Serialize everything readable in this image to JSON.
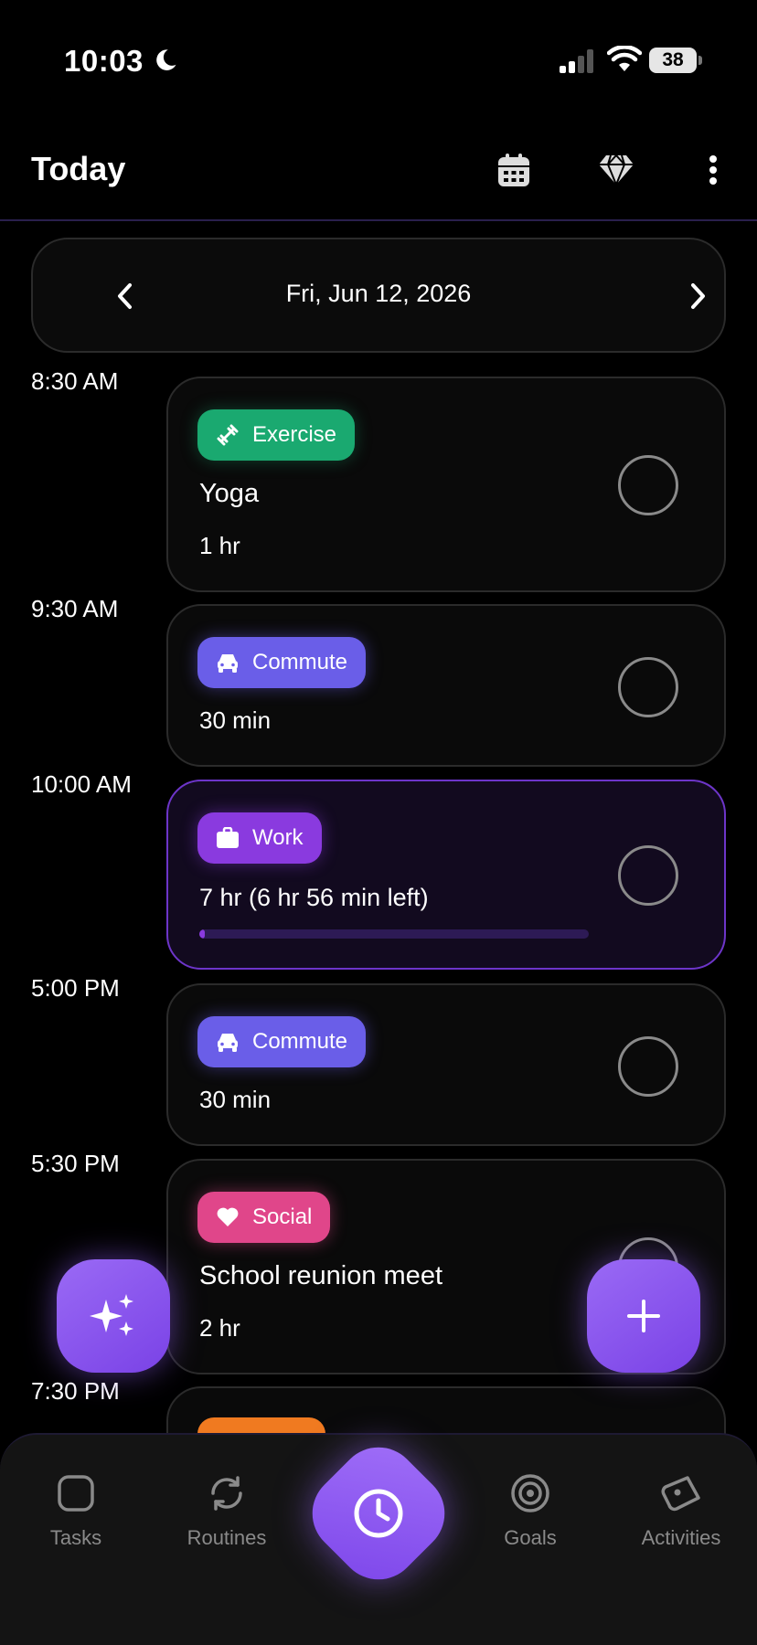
{
  "status": {
    "time": "10:03",
    "battery": "38"
  },
  "header": {
    "title": "Today"
  },
  "date_nav": {
    "date": "Fri, Jun 12, 2026"
  },
  "timeline": [
    {
      "time": "8:30 AM",
      "tag": "Exercise",
      "title": "Yoga",
      "duration": "1 hr"
    },
    {
      "time": "9:30 AM",
      "tag": "Commute",
      "duration": "30 min"
    },
    {
      "time": "10:00 AM",
      "tag": "Work",
      "duration": "7 hr  (6 hr 56 min left)",
      "progress": 0.01
    },
    {
      "time": "5:00 PM",
      "tag": "Commute",
      "duration": "30 min"
    },
    {
      "time": "5:30 PM",
      "tag": "Social",
      "title": "School reunion meet",
      "duration": "2 hr"
    },
    {
      "time": "7:30 PM"
    }
  ],
  "bottom_nav": {
    "tasks": "Tasks",
    "routines": "Routines",
    "goals": "Goals",
    "activities": "Activities"
  },
  "colors": {
    "accent": "#8a3adf",
    "exercise": "#1aa970",
    "commute": "#6a5ee8",
    "social": "#e0468a"
  }
}
